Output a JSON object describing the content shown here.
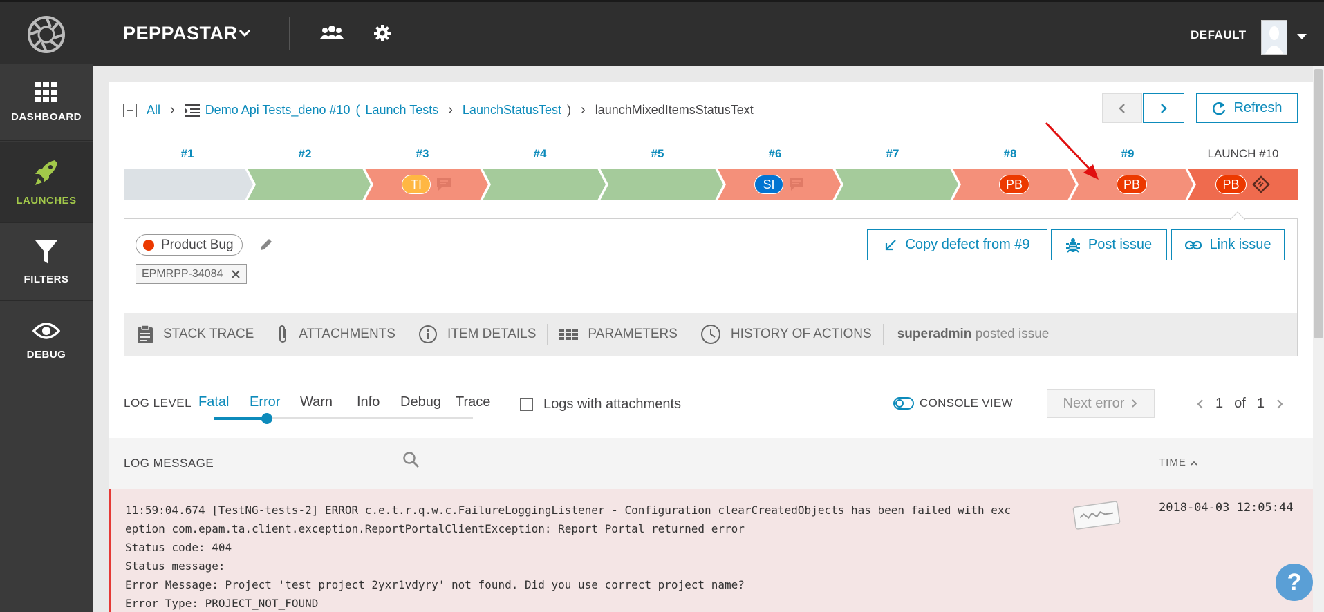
{
  "header": {
    "project_name": "PEPPASTAR",
    "user_project": "DEFAULT"
  },
  "sidebar": {
    "items": [
      {
        "label": "DASHBOARD",
        "icon": "dashboard-grid-icon"
      },
      {
        "label": "LAUNCHES",
        "icon": "rocket-icon",
        "active": true
      },
      {
        "label": "FILTERS",
        "icon": "filter-funnel-icon"
      },
      {
        "label": "DEBUG",
        "icon": "eye-icon"
      }
    ]
  },
  "breadcrumb": {
    "all": "All",
    "launch": "Demo Api Tests_deno #10",
    "open_paren": "(",
    "suite": "Launch Tests",
    "test": "LaunchStatusTest",
    "close_paren": ")",
    "item": "launchMixedItemsStatusText"
  },
  "toolbar": {
    "refresh_label": "Refresh"
  },
  "history": {
    "labels": [
      "#1",
      "#2",
      "#3",
      "#4",
      "#5",
      "#6",
      "#7",
      "#8",
      "#9",
      "LAUNCH #10"
    ],
    "badges": {
      "run3": "TI",
      "run6": "SI",
      "run8": "PB",
      "run9": "PB",
      "run10": "PB"
    },
    "colors": {
      "skipped": "#dce1e5",
      "passed": "#a5cb9b",
      "failed": "#f4907a",
      "current": "#ef6b4e",
      "ti": "#ffb743",
      "si": "#0274d1",
      "pb": "#ec3900"
    }
  },
  "defect": {
    "type": "Product Bug",
    "issue_tag": "EPMRPP-34084",
    "copy_label": "Copy defect from #9",
    "post_label": "Post issue",
    "link_label": "Link issue"
  },
  "tabs": {
    "stack_trace": "STACK TRACE",
    "attachments": "ATTACHMENTS",
    "item_details": "ITEM DETAILS",
    "parameters": "PARAMETERS",
    "history": "HISTORY OF ACTIONS",
    "posted_user": "superadmin",
    "posted_text": "posted issue"
  },
  "log_level": {
    "label": "LOG LEVEL",
    "levels": [
      "Fatal",
      "Error",
      "Warn",
      "Info",
      "Debug",
      "Trace"
    ],
    "selected": "Error",
    "attachments_label": "Logs with attachments",
    "console_view": "CONSOLE VIEW",
    "next_error": "Next error",
    "page_current": "1",
    "page_of": "of",
    "page_total": "1"
  },
  "log_table": {
    "message_header": "LOG MESSAGE",
    "time_header": "TIME",
    "rows": [
      {
        "message": "11:59:04.674 [TestNG-tests-2] ERROR c.e.t.r.q.w.c.FailureLoggingListener - Configuration clearCreatedObjects has been failed with exc\neption com.epam.ta.client.exception.ReportPortalClientException: Report Portal returned error\nStatus code: 404\nStatus message:\nError Message: Project 'test_project_2yxr1vdyry' not found. Did you use correct project name?\nError Type: PROJECT_NOT_FOUND",
        "time": "2018-04-03 12:05:44",
        "level": "error"
      }
    ]
  },
  "help": "?"
}
